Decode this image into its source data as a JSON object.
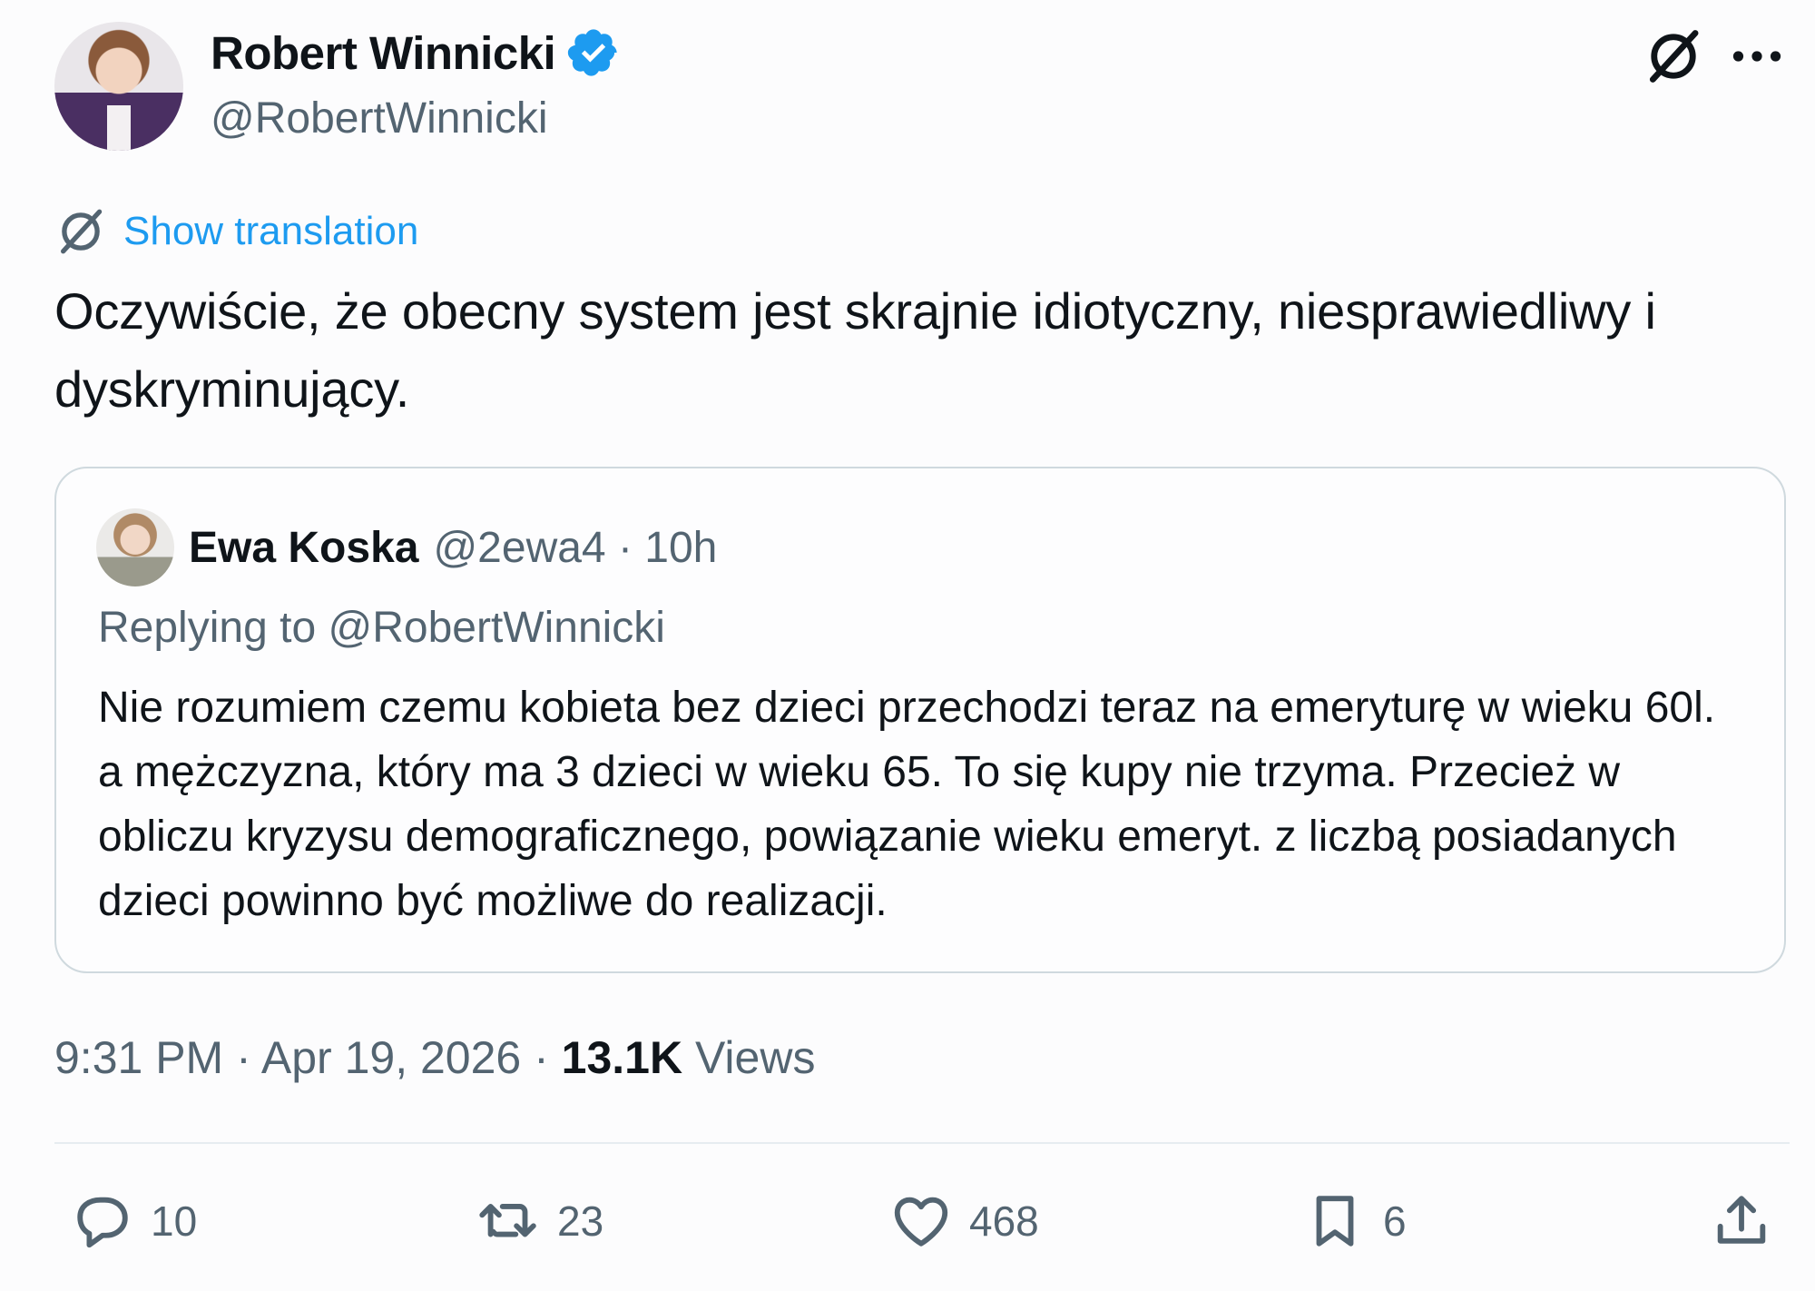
{
  "author": {
    "name": "Robert Winnicki",
    "handle": "@RobertWinnicki",
    "verified_icon": "verified-badge-icon"
  },
  "header_icons": [
    "grok-icon",
    "more-icon"
  ],
  "translation": {
    "label": "Show translation",
    "icon": "translate-icon"
  },
  "tweet": {
    "text": "Oczywiście, że obecny system jest skrajnie idiotyczny, niesprawiedliwy i dyskryminujący."
  },
  "quote": {
    "author_name": "Ewa Koska",
    "meta": "@2ewa4 · 10h",
    "replying_to": "Replying to @RobertWinnicki",
    "text": "Nie rozumiem czemu kobieta bez dzieci przechodzi teraz na emeryturę w wieku 60l. a mężczyzna, który ma 3 dzieci w wieku 65. To się kupy nie trzyma. Przecież w obliczu kryzysu demograficznego, powiązanie wieku emeryt. z liczbą posiadanych dzieci powinno być możliwe do realizacji."
  },
  "meta": {
    "time": "9:31 PM · Apr 19, 2026 · ",
    "views_count": "13.1K",
    "views_label": " Views"
  },
  "actions": {
    "replies": "10",
    "retweets": "23",
    "likes": "468",
    "bookmarks": "6"
  },
  "colors": {
    "accent": "#1d9bf0",
    "secondary_text": "#536471",
    "primary_text": "#0f1419",
    "border": "#cfd9de"
  }
}
